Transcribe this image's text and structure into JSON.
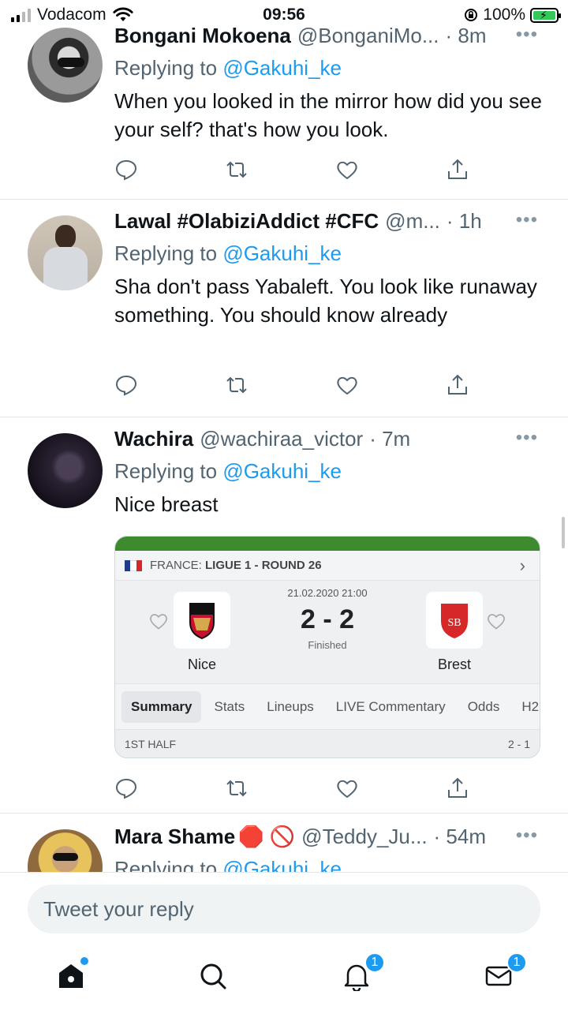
{
  "status_bar": {
    "carrier": "Vodacom",
    "time": "09:56",
    "battery": "100%",
    "icons": [
      "signal-icon",
      "wifi-icon",
      "rotation-lock-icon",
      "battery-charging-icon"
    ]
  },
  "tweets": [
    {
      "name": "Bongani Mokoena",
      "handle": "@BonganiMo...",
      "time": "· 8m",
      "more": "•••",
      "reply_prefix": "Replying to",
      "reply_to": "@Gakuhi_ke",
      "text": "When you looked in the mirror how did you see your self? that's how you look."
    },
    {
      "name": "Lawal #OlabiziAddict #CFC",
      "handle": "@m...",
      "time": "· 1h",
      "more": "•••",
      "reply_prefix": "Replying to",
      "reply_to": "@Gakuhi_ke",
      "text": "Sha don't pass Yabaleft. You look like runaway something. You should know already"
    },
    {
      "name": "Wachira",
      "handle": "@wachiraa_victor",
      "time": "· 7m",
      "more": "•••",
      "reply_prefix": "Replying to",
      "reply_to": "@Gakuhi_ke",
      "text": "Nice breast",
      "card": {
        "country": "FRANCE:",
        "league": "LIGUE 1 - ROUND 26",
        "date": "21.02.2020 21:00",
        "score": "2 - 2",
        "status": "Finished",
        "home_team": "Nice",
        "away_team": "Brest",
        "tabs": [
          "Summary",
          "Stats",
          "Lineups",
          "LIVE Commentary",
          "Odds",
          "H2"
        ],
        "active_tab": "Summary",
        "half_label": "1ST HALF",
        "half_score": "2 - 1",
        "flag_colors": [
          "#1f3b8c",
          "#ffffff",
          "#d62828"
        ]
      }
    },
    {
      "name": "Mara Shame",
      "name_emoji": "🛑 🚫",
      "handle": "@Teddy_Ju...",
      "time": "· 54m",
      "more": "•••",
      "reply_prefix": "Replying to",
      "reply_to": "@Gakuhi_ke"
    }
  ],
  "reply_box": {
    "placeholder": "Tweet your reply"
  },
  "nav": {
    "items": [
      "home-icon",
      "search-icon",
      "notifications-icon",
      "messages-icon"
    ],
    "notifications_badge": "1",
    "messages_badge": "1"
  },
  "colors": {
    "accent": "#1d9bf0",
    "secondary_text": "#536471",
    "card_bar": "#3d8b2e"
  }
}
